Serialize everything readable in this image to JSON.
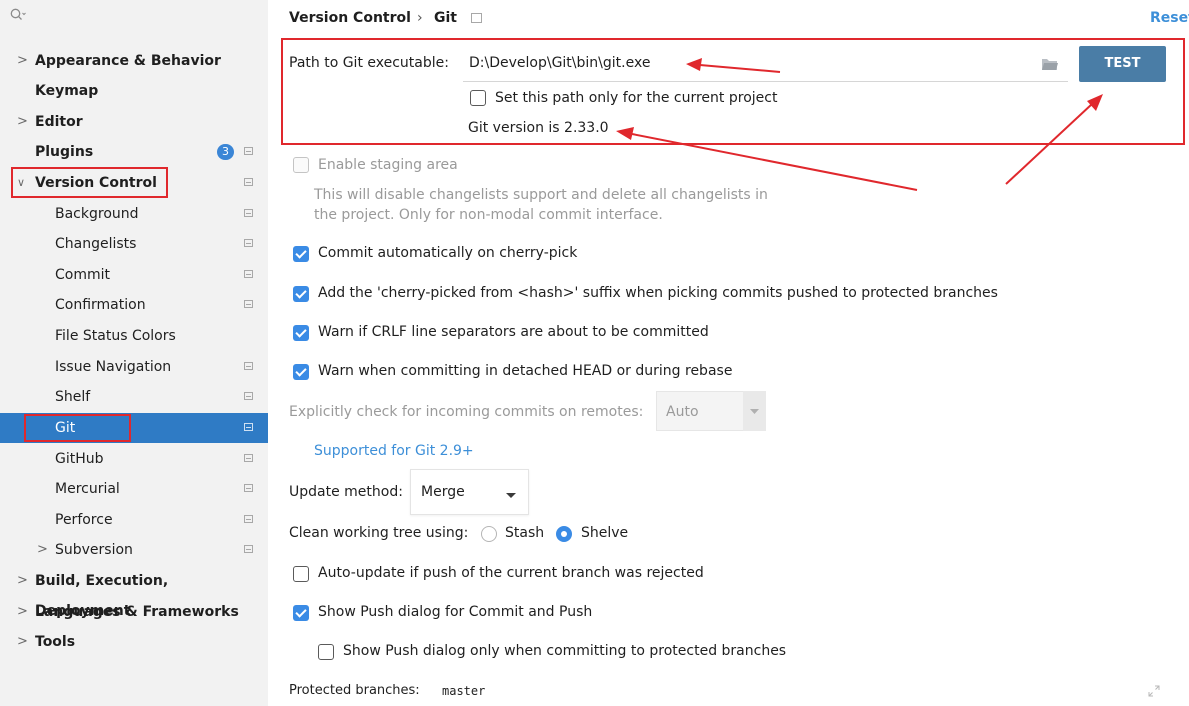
{
  "sidebar": {
    "search_icon": "search-icon",
    "items": [
      {
        "label": "Appearance & Behavior"
      },
      {
        "label": "Keymap"
      },
      {
        "label": "Editor"
      },
      {
        "label": "Plugins",
        "badge": "3"
      },
      {
        "label": "Version Control"
      },
      {
        "label": "Background"
      },
      {
        "label": "Changelists"
      },
      {
        "label": "Commit"
      },
      {
        "label": "Confirmation"
      },
      {
        "label": "File Status Colors"
      },
      {
        "label": "Issue Navigation"
      },
      {
        "label": "Shelf"
      },
      {
        "label": "Git"
      },
      {
        "label": "GitHub"
      },
      {
        "label": "Mercurial"
      },
      {
        "label": "Perforce"
      },
      {
        "label": "Subversion"
      },
      {
        "label": "Build, Execution, Deployment"
      },
      {
        "label": "Languages & Frameworks"
      },
      {
        "label": "Tools"
      }
    ]
  },
  "header": {
    "breadcrumb_parent": "Version Control",
    "breadcrumb_separator": "›",
    "breadcrumb_current": "Git",
    "reset_label": "Reset"
  },
  "git": {
    "path_label": "Path to Git executable:",
    "path_value": "D:\\Develop\\Git\\bin\\git.exe",
    "test_label": "TEST",
    "project_only_label": "Set this path only for the current project",
    "version_text": "Git version is 2.33.0"
  },
  "options": {
    "staging_label": "Enable staging area",
    "staging_desc_1": "This will disable changelists support and delete all changelists in",
    "staging_desc_2": "the project. Only for non-modal commit interface.",
    "cherry_commit_label": "Commit automatically on cherry-pick",
    "cherry_suffix_label": "Add the 'cherry-picked from <hash>' suffix when picking commits pushed to protected branches",
    "crlf_label": "Warn if CRLF line separators are about to be committed",
    "detached_label": "Warn when committing in detached HEAD or during rebase",
    "incoming_label": "Explicitly check for incoming commits on remotes:",
    "incoming_value": "Auto",
    "supported_link": "Supported for Git 2.9+",
    "update_method_label": "Update method:",
    "update_method_value": "Merge",
    "clean_label": "Clean working tree using:",
    "stash_label": "Stash",
    "shelve_label": "Shelve",
    "auto_update_label": "Auto-update if push of the current branch was rejected",
    "show_push_label": "Show Push dialog for Commit and Push",
    "show_push_protected_label": "Show Push dialog only when committing to protected branches",
    "protected_label": "Protected branches:",
    "protected_value": "master"
  },
  "colors": {
    "selection": "#2f7bc5",
    "annotation_red": "#e0282d",
    "checkbox_blue": "#3a8be5",
    "test_button": "#4a7da6",
    "link_blue": "#3d8fd8"
  }
}
